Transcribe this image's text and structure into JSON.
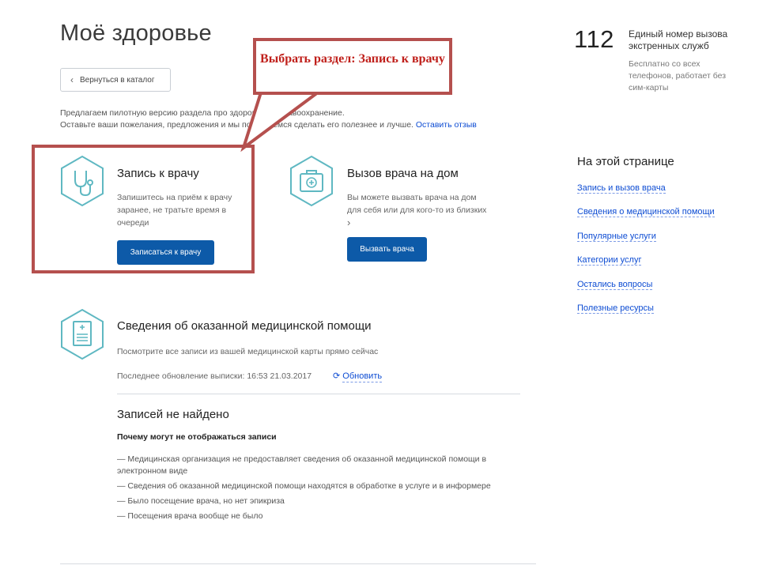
{
  "page": {
    "title": "Моё здоровье",
    "back_label": "Вернуться в каталог",
    "intro_line1": "Предлагаем пилотную версию раздела про здоровье и здравоохранение.",
    "intro_line2": "Оставьте ваши пожелания, предложения и мы постараемся сделать его полезнее и лучше.",
    "feedback_link": "Оставить отзыв"
  },
  "callout": {
    "text": "Выбрать раздел: Запись к врачу"
  },
  "emergency": {
    "number": "112",
    "title": "Единый номер вызова экстренных служб",
    "subtitle": "Бесплатно со всех телефонов, работает без сим-карты"
  },
  "toc": {
    "heading": "На этой странице",
    "items": [
      "Запись и вызов врача",
      "Сведения о медицинской помощи",
      "Популярные услуги",
      "Категории услуг",
      "Остались вопросы",
      "Полезные ресурсы"
    ]
  },
  "services": {
    "appointment": {
      "title": "Запись к врачу",
      "description": "Запишитесь на приём к врачу заранее, не тратьте время в очереди",
      "button": "Записаться к врачу",
      "icon": "stethoscope-icon"
    },
    "home_visit": {
      "title": "Вызов врача на дом",
      "description": "Вы можете вызвать врача на дом для себя или для кого-то из близких",
      "button": "Вызвать врача",
      "icon": "first-aid-kit-icon"
    }
  },
  "medical_info": {
    "title": "Сведения об оказанной медицинской помощи",
    "description": "Посмотрите все записи из вашей медицинской карты прямо сейчас",
    "last_update": "Последнее обновление выписки: 16:53 21.03.2017",
    "refresh_label": "Обновить",
    "icon": "medical-document-icon"
  },
  "not_found": {
    "title": "Записей не найдено",
    "why": "Почему могут не отображаться записи",
    "reasons": [
      "— Медицинская организация не предоставляет сведения об оказанной медицинской помощи в электронном виде",
      "— Сведения об оказанной медицинской помощи находятся в обработке в услуге и в информере",
      "— Было посещение врача, но нет эпикриза",
      "— Посещения врача вообще не было"
    ]
  },
  "colors": {
    "accent_blue": "#0d5aa8",
    "link_blue": "#0d4cd3",
    "icon_teal": "#5fb8c2",
    "callout_red": "#b5504e",
    "callout_text": "#c0201b"
  }
}
